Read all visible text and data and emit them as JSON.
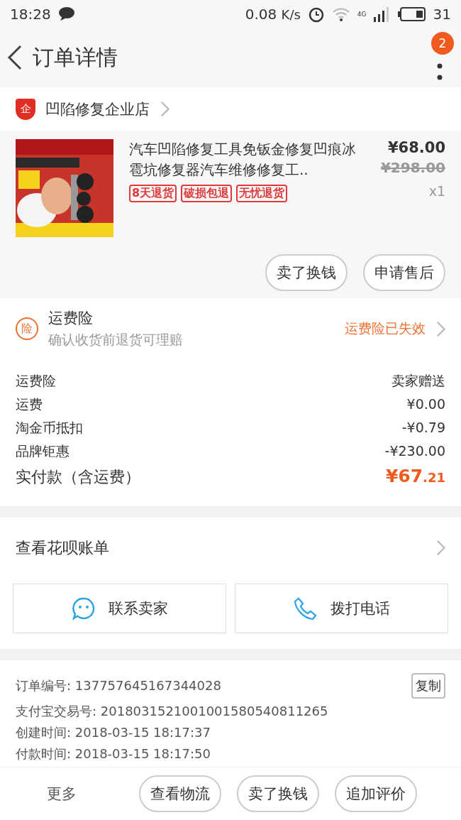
{
  "status_bar": {
    "time": "18:28",
    "speed": "0.08",
    "speed_unit": "K/s",
    "network": "4G",
    "battery": "31"
  },
  "header": {
    "title": "订单详情",
    "badge": "2"
  },
  "shop": {
    "name": "凹陷修复企业店",
    "logo": "企"
  },
  "product": {
    "image": {
      "kind": "picture"
    },
    "title": "汽车凹陷修复工具免钣金修复凹痕冰雹坑修复器汽车维修修复工..",
    "tags": [
      "8天退货",
      "破损包退",
      "无忧退货"
    ],
    "price": "¥68.00",
    "original_price": "¥298.00",
    "quantity": "x1",
    "actions": [
      "卖了换钱",
      "申请售后"
    ]
  },
  "insurance": {
    "icon": "险",
    "title": "运费险",
    "subtitle": "确认收货前退货可理赔",
    "status": "运费险已失效"
  },
  "costs": [
    {
      "label": "运费险",
      "value": "卖家赠送",
      "kind": "plain"
    },
    {
      "label": "运费",
      "value": "¥0.00",
      "kind": "plain"
    },
    {
      "label": "淘金币抵扣",
      "value": "-¥0.79",
      "kind": "plain"
    },
    {
      "label": "品牌钜惠",
      "value": "-¥230.00",
      "kind": "plain"
    },
    {
      "label": "实付款（含运费）",
      "value": "¥67",
      "value_decimal": ".21",
      "kind": "total"
    }
  ],
  "huabei": {
    "label": "查看花呗账单"
  },
  "contact": [
    {
      "label": "联系卖家",
      "kind": "chat"
    },
    {
      "label": "拨打电话",
      "kind": "phone"
    }
  ],
  "order_info": {
    "copy_button": "复制",
    "rows": [
      "订单编号: 137757645167344028",
      "支付宝交易号: 2018031521001001580540811265",
      "创建时间: 2018-03-15 18:17:37",
      "付款时间: 2018-03-15 18:17:50"
    ]
  },
  "bottom_bar": {
    "more": "更多",
    "buttons": [
      "查看物流",
      "卖了换钱",
      "追加评价"
    ]
  }
}
